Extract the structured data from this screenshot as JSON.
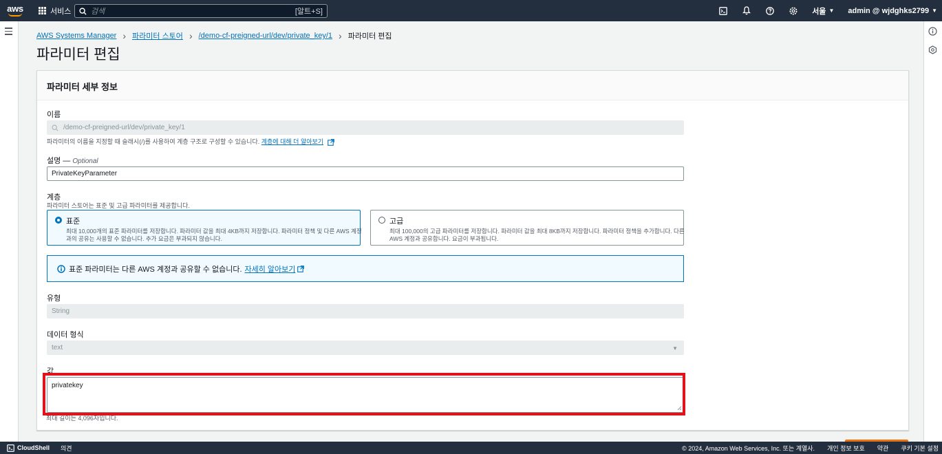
{
  "topnav": {
    "logo_text": "aws",
    "services_label": "서비스",
    "search_placeholder": "검색",
    "search_shortcut": "[알트+S]",
    "region": "서울",
    "account": "admin @ wjdghks2799"
  },
  "breadcrumb": {
    "items": [
      "AWS Systems Manager",
      "파라미터 스토어",
      "/demo-cf-preigned-url/dev/private_key/1"
    ],
    "current": "파라미터 편집"
  },
  "page_title": "파라미터 편집",
  "panel": {
    "header": "파라미터 세부 정보",
    "name": {
      "label": "이름",
      "value": "/demo-cf-preigned-url/dev/private_key/1",
      "hint": "파라미터의 이름을 지정할 때 슬래시(/)를 사용하여 계층 구조로 구성할 수 있습니다.",
      "hint_link": "계층에 대해 더 알아보기"
    },
    "description": {
      "label": "설명",
      "optional": "Optional",
      "value": "PrivateKeyParameter"
    },
    "tier": {
      "label": "계층",
      "hint": "파라미터 스토어는 표준 및 고급 파라미터를 제공합니다.",
      "standard_title": "표준",
      "standard_desc": "최대 10,000개의 표준 파라미터를 저장합니다. 파라미터 값을 최대 4KB까지 저장합니다. 파라미터 정책 및 다른 AWS 계정과의 공유는 사용할 수 없습니다. 추가 요금은 부과되지 않습니다.",
      "advanced_title": "고급",
      "advanced_desc": "최대 100,000의 고급 파라미터를 저장합니다. 파라미터 값을 최대 8KB까지 저장합니다. 파라미터 정책을 추가합니다. 다른 AWS 계정과 공유합니다. 요금이 부과됩니다."
    },
    "info": {
      "text": "표준 파라미터는 다른 AWS 계정과 공유할 수 없습니다.",
      "link": "자세히 알아보기"
    },
    "type": {
      "label": "유형",
      "value": "String"
    },
    "data_type": {
      "label": "데이터 형식",
      "value": "text"
    },
    "value": {
      "label": "값",
      "value": "privatekey",
      "hint": "최대 길이는 4,096자입니다."
    }
  },
  "footer": {
    "cloudshell": "CloudShell",
    "feedback": "의견",
    "copyright": "© 2024, Amazon Web Services, Inc. 또는 계열사.",
    "privacy": "개인 정보 보호",
    "terms": "약관",
    "cookie": "쿠키 기본 설정"
  },
  "colors": {
    "accent": "#0073bb",
    "nav": "#232f3e",
    "highlight": "#e0121a",
    "orange": "#ff9900"
  }
}
